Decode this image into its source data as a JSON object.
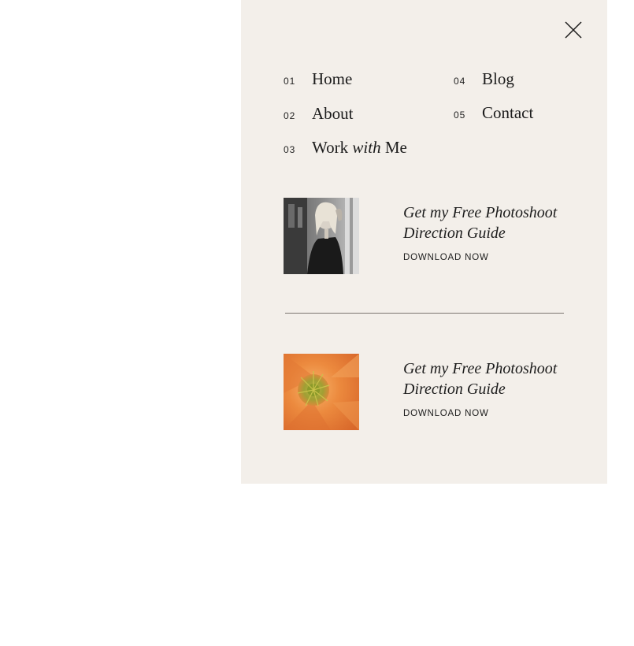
{
  "menu": {
    "close_icon": "close-icon",
    "nav": [
      {
        "num": "01",
        "label": "Home"
      },
      {
        "num": "02",
        "label": "About"
      },
      {
        "num": "03",
        "label_pre": "Work ",
        "label_em": "with",
        "label_post": " Me"
      },
      {
        "num": "04",
        "label": "Blog"
      },
      {
        "num": "05",
        "label": "Contact"
      }
    ]
  },
  "promos": [
    {
      "title": "Get my Free Photoshoot Direction Guide",
      "cta": "DOWNLOAD NOW",
      "image": "portrait-photo"
    },
    {
      "title": "Get my Free Photoshoot Direction Guide",
      "cta": "DOWNLOAD NOW",
      "image": "orange-poppy-photo"
    }
  ],
  "colors": {
    "panel_bg": "#f3efea",
    "text": "#1c1c1c",
    "divider": "#7c7670"
  }
}
